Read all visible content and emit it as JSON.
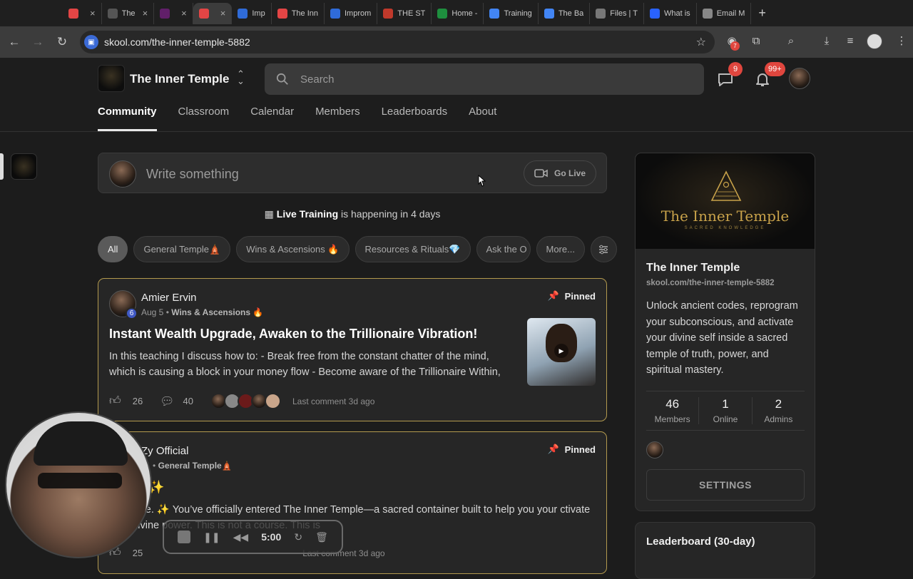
{
  "browser": {
    "tabs": [
      {
        "title": "",
        "icon": "record-icon",
        "color": "#e34545"
      },
      {
        "title": "The",
        "icon": "openai-icon",
        "color": "#555555"
      },
      {
        "title": "",
        "icon": "slack-icon",
        "color": "#611f69"
      },
      {
        "title": "",
        "icon": "skool-icon",
        "color": "#e34545",
        "active": true
      },
      {
        "title": "Imp",
        "icon": "flow-icon",
        "color": "#2f6bd8"
      },
      {
        "title": "The Inn",
        "icon": "skool-icon",
        "color": "#e34545"
      },
      {
        "title": "Improm",
        "icon": "flow-icon",
        "color": "#2f6bd8"
      },
      {
        "title": "THE ST",
        "icon": "shield-icon",
        "color": "#c0392b"
      },
      {
        "title": "Home -",
        "icon": "drive-icon",
        "color": "#1e8e3e"
      },
      {
        "title": "Training",
        "icon": "docs-icon",
        "color": "#4285f4"
      },
      {
        "title": "The Ba",
        "icon": "docs-icon",
        "color": "#4285f4"
      },
      {
        "title": "Files | T",
        "icon": "globe-icon",
        "color": "#777777"
      },
      {
        "title": "What is",
        "icon": "c-icon",
        "color": "#2962ff"
      },
      {
        "title": "Email M",
        "icon": "gear-icon",
        "color": "#888888"
      }
    ],
    "url": "skool.com/the-inner-temple-5882",
    "ext_badge": "7"
  },
  "header": {
    "group_name": "The Inner Temple",
    "search_placeholder": "Search",
    "chat_badge": "9",
    "notif_badge": "99+",
    "nav": [
      "Community",
      "Classroom",
      "Calendar",
      "Members",
      "Leaderboards",
      "About"
    ]
  },
  "composer": {
    "placeholder": "Write something",
    "go_live": "Go Live"
  },
  "event": {
    "name": "Live Training",
    "text": "is happening in 4 days"
  },
  "filters": [
    "All",
    "General Temple🛕",
    "Wins & Ascensions 🔥",
    "Resources & Rituals💎",
    "Ask the O",
    "More..."
  ],
  "posts": [
    {
      "author": "Amier Ervin",
      "level": "6",
      "date": "Aug 5",
      "category": "Wins & Ascensions 🔥",
      "pinned": "Pinned",
      "title": "Instant Wealth Upgrade, Awaken to the Trillionaire Vibration!",
      "body": "In this teaching I discuss how to: - Break free from the constant chatter of the mind, which is causing a block in your money flow - Become aware of the Trillionaire Within,",
      "likes": "26",
      "comments": "40",
      "last_comment": "Last comment 3d ago"
    },
    {
      "author": "Zy Official",
      "level": "",
      "date": "l 1",
      "category": "General Temple🛕",
      "pinned": "Pinned",
      "title": "HERE ✨",
      "body": "e, Initiate. ✨ You’ve officially entered The Inner Temple—a sacred container built to help you your                 ctivate your divine power. This is not a course. This is",
      "likes": "25",
      "comments": "",
      "last_comment": "Last comment 3d ago"
    }
  ],
  "about": {
    "banner_name": "The Inner Temple",
    "banner_sub": "SACRED KNOWLEDGE",
    "title": "The Inner Temple",
    "url": "skool.com/the-inner-temple-5882",
    "description": "Unlock ancient codes, reprogram your subconscious, and activate your divine self inside a sacred temple of truth, power, and spiritual mastery.",
    "stats": [
      {
        "value": "46",
        "label": "Members"
      },
      {
        "value": "1",
        "label": "Online"
      },
      {
        "value": "2",
        "label": "Admins"
      }
    ],
    "settings": "SETTINGS"
  },
  "leaderboard": {
    "title": "Leaderboard (30-day)"
  },
  "recorder": {
    "time": "5:00"
  },
  "colors": {
    "accent_border": "#b39a4e",
    "badge": "#e0463e",
    "level": "#4059c4"
  }
}
